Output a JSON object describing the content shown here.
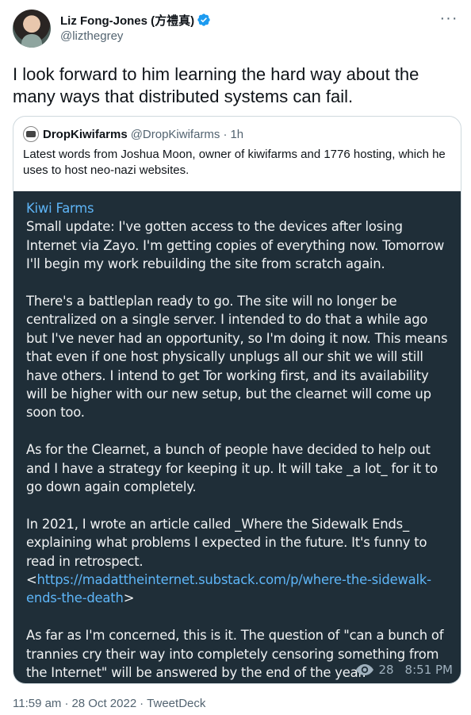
{
  "author": {
    "display_name": "Liz Fong-Jones (方禮真)",
    "handle": "@lizthegrey",
    "verified_icon": "verified-badge-icon"
  },
  "tweet": {
    "text": "I look forward to him learning the hard way about the many ways that distributed systems can fail."
  },
  "quote": {
    "name": "DropKiwifarms",
    "handle": "@DropKiwifarms",
    "dot": "·",
    "time": "1h",
    "text": "Latest words from Joshua Moon, owner of kiwifarms and 1776 hosting, which he uses to host neo-nazi websites."
  },
  "telegram": {
    "channel": "Kiwi Farms",
    "para1": "Small update: I've gotten access to the devices after losing Internet via Zayo. I'm getting copies of everything now. Tomorrow I'll begin my work rebuilding the site from scratch again.",
    "para2": "There's a battleplan ready to go. The site will no longer be centralized on a single server. I intended to do that a while ago but I've never had an opportunity, so I'm doing it now. This means that even if one host physically unplugs all our shit we will still have others. I intend to get Tor working first, and its availability will be higher with our new setup, but the clearnet will come up soon too.",
    "para3": "As for the Clearnet, a bunch of people have decided to help out and I have a strategy for keeping it up. It will take _a lot_ for it to go down again completely.",
    "para4": "In 2021, I wrote an article called _Where the Sidewalk Ends_ explaining what problems I expected in the future. It's funny to read in retrospect.",
    "link_open": "<",
    "link": "https://madattheinternet.substack.com/p/where-the-sidewalk-ends-the-death",
    "link_close": ">",
    "para5": "As far as I'm concerned, this is it. The question of \"can a bunch of trannies cry their way into completely censoring something from the Internet\" will be answered by the end of the year.",
    "views": "28",
    "time": "8:51 PM"
  },
  "footer": {
    "time": "11:59 am",
    "dot1": "·",
    "date": "28 Oct 2022",
    "dot2": "·",
    "source": "TweetDeck"
  },
  "colors": {
    "verified": "#1d9bf0",
    "telegram_bg": "#1f2e38",
    "telegram_link": "#5eb5f7",
    "muted": "#536471"
  }
}
